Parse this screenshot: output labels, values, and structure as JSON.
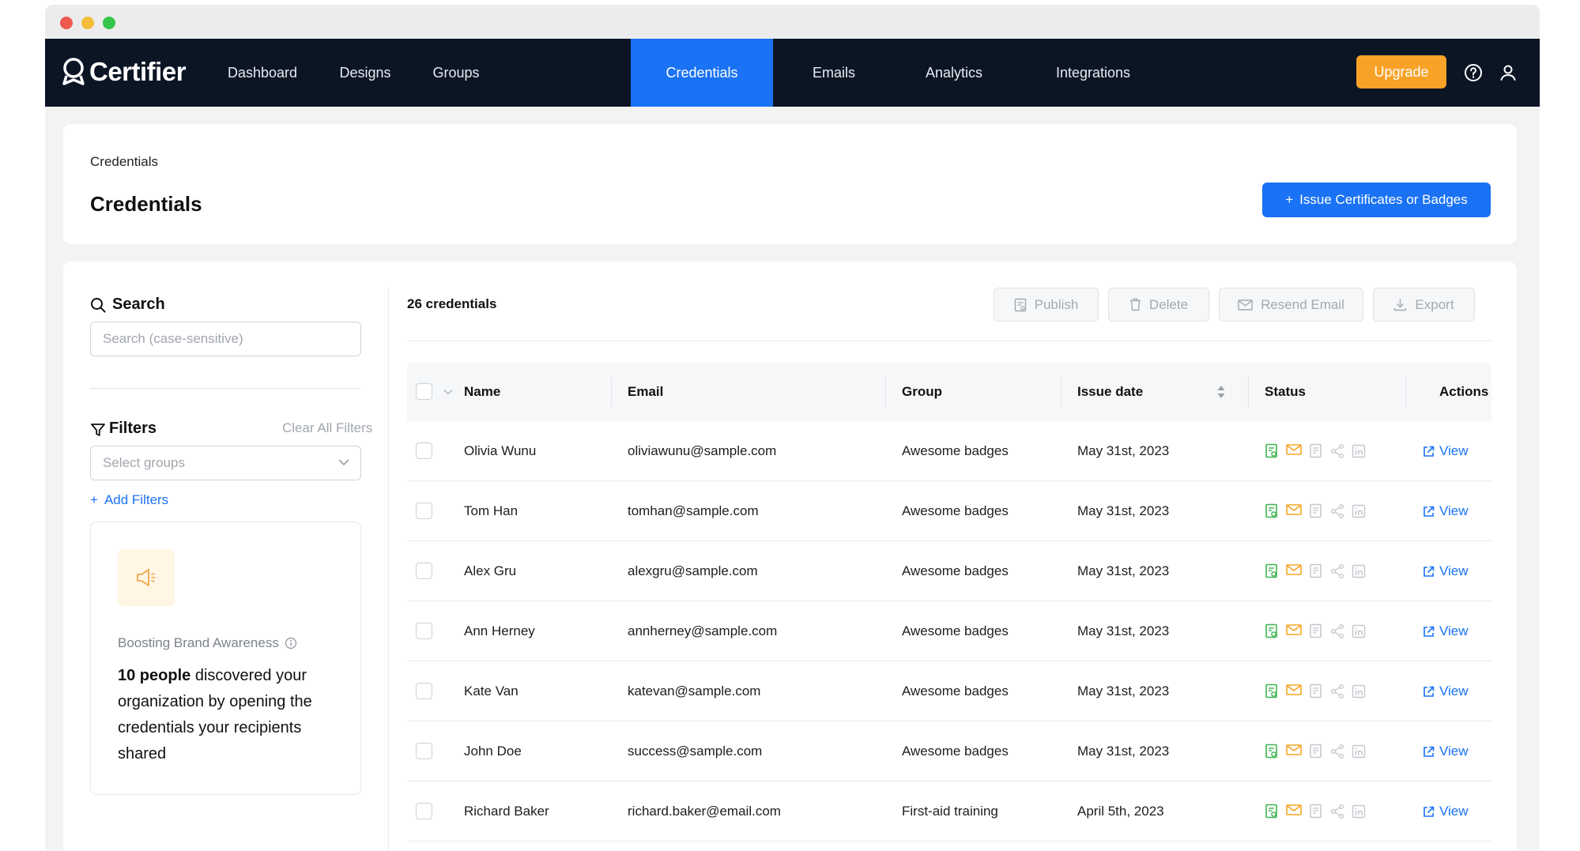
{
  "app": {
    "logo_text": "Certifier",
    "nav": [
      {
        "label": "Dashboard",
        "active": false
      },
      {
        "label": "Designs",
        "active": false
      },
      {
        "label": "Groups",
        "active": false
      },
      {
        "label": "Credentials",
        "active": true
      },
      {
        "label": "Emails",
        "active": false
      },
      {
        "label": "Analytics",
        "active": false
      },
      {
        "label": "Integrations",
        "active": false
      }
    ],
    "upgrade_label": "Upgrade",
    "accent_color": "#1a72f5",
    "upgrade_color": "#f8a227"
  },
  "header": {
    "breadcrumb": "Credentials",
    "title": "Credentials",
    "issue_button": "Issue Certificates or Badges"
  },
  "sidebar": {
    "search_label": "Search",
    "search_placeholder": "Search (case-sensitive)",
    "filters_label": "Filters",
    "clear_filters": "Clear All Filters",
    "select_groups_placeholder": "Select groups",
    "add_filters": "Add Filters",
    "promo": {
      "kicker": "Boosting Brand Awareness",
      "count_bold": "10 people",
      "text": " discovered your organization by opening the credentials your recipients shared"
    }
  },
  "table": {
    "count_label": "26 credentials",
    "toolbar": {
      "publish": "Publish",
      "delete": "Delete",
      "resend": "Resend Email",
      "export": "Export"
    },
    "columns": {
      "name": "Name",
      "email": "Email",
      "group": "Group",
      "issue_date": "Issue date",
      "status": "Status",
      "actions": "Actions"
    },
    "view_label": "View",
    "rows": [
      {
        "name": "Olivia Wunu",
        "email": "oliviawunu@sample.com",
        "group": "Awesome badges",
        "date": "May 31st, 2023"
      },
      {
        "name": "Tom Han",
        "email": "tomhan@sample.com",
        "group": "Awesome badges",
        "date": "May 31st, 2023"
      },
      {
        "name": "Alex Gru",
        "email": "alexgru@sample.com",
        "group": "Awesome badges",
        "date": "May 31st, 2023"
      },
      {
        "name": "Ann Herney",
        "email": "annherney@sample.com",
        "group": "Awesome badges",
        "date": "May 31st, 2023"
      },
      {
        "name": "Kate Van",
        "email": "katevan@sample.com",
        "group": "Awesome badges",
        "date": "May 31st, 2023"
      },
      {
        "name": "John Doe",
        "email": "success@sample.com",
        "group": "Awesome badges",
        "date": "May 31st, 2023"
      },
      {
        "name": "Richard Baker",
        "email": "richard.baker@email.com",
        "group": "First-aid training",
        "date": "April 5th, 2023"
      }
    ],
    "status_icons": [
      "published-icon",
      "email-sent-icon",
      "opened-icon",
      "shared-icon",
      "linkedin-icon"
    ]
  }
}
